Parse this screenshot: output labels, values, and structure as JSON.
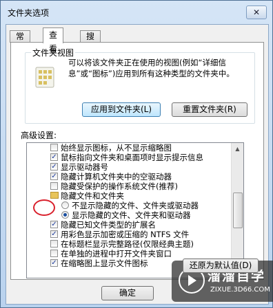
{
  "window": {
    "title": "文件夹选项",
    "close_label": "✕"
  },
  "tabs": [
    {
      "label": "常规",
      "active": false
    },
    {
      "label": "查看",
      "active": true
    },
    {
      "label": "搜索",
      "active": false
    }
  ],
  "folder_views": {
    "legend": "文件夹视图",
    "description": "可以将该文件夹正在使用的视图(例如“详细信息”或“图标”)应用到所有这种类型的文件夹中。",
    "apply_button": "应用到文件夹(L)",
    "reset_button": "重置文件夹(R)"
  },
  "advanced": {
    "label": "高级设置:",
    "items": [
      {
        "type": "checkbox",
        "checked": false,
        "indent": 0,
        "label": "始终显示图标，从不显示缩略图"
      },
      {
        "type": "checkbox",
        "checked": true,
        "indent": 0,
        "label": "鼠标指向文件夹和桌面项时显示提示信息"
      },
      {
        "type": "checkbox",
        "checked": true,
        "indent": 0,
        "label": "显示驱动器号"
      },
      {
        "type": "checkbox",
        "checked": true,
        "indent": 0,
        "label": "隐藏计算机文件夹中的空驱动器"
      },
      {
        "type": "checkbox",
        "checked": false,
        "indent": 0,
        "label": "隐藏受保护的操作系统文件(推荐)"
      },
      {
        "type": "folder",
        "checked": false,
        "indent": 0,
        "label": "隐藏文件和文件夹"
      },
      {
        "type": "radio",
        "checked": false,
        "indent": 1,
        "label": "不显示隐藏的文件、文件夹或驱动器"
      },
      {
        "type": "radio",
        "checked": true,
        "indent": 1,
        "label": "显示隐藏的文件、文件夹和驱动器"
      },
      {
        "type": "checkbox",
        "checked": true,
        "indent": 0,
        "label": "隐藏已知文件类型的扩展名"
      },
      {
        "type": "checkbox",
        "checked": true,
        "indent": 0,
        "label": "用彩色显示加密或压缩的 NTFS 文件"
      },
      {
        "type": "checkbox",
        "checked": false,
        "indent": 0,
        "label": "在标题栏显示完整路径(仅限经典主题)"
      },
      {
        "type": "checkbox",
        "checked": false,
        "indent": 0,
        "label": "在单独的进程中打开文件夹窗口"
      },
      {
        "type": "checkbox",
        "checked": true,
        "indent": 0,
        "label": "在缩略图上显示文件图标"
      }
    ],
    "restore_button": "还原为默认值(D)"
  },
  "footer": {
    "ok_button": "确定"
  },
  "watermark": {
    "brand": "溜溜自学",
    "url": "ZIXUE.3D66.COM"
  },
  "colors": {
    "annotation_circle": "#d9202c",
    "checkbox_mark": "#1b3a9c"
  }
}
